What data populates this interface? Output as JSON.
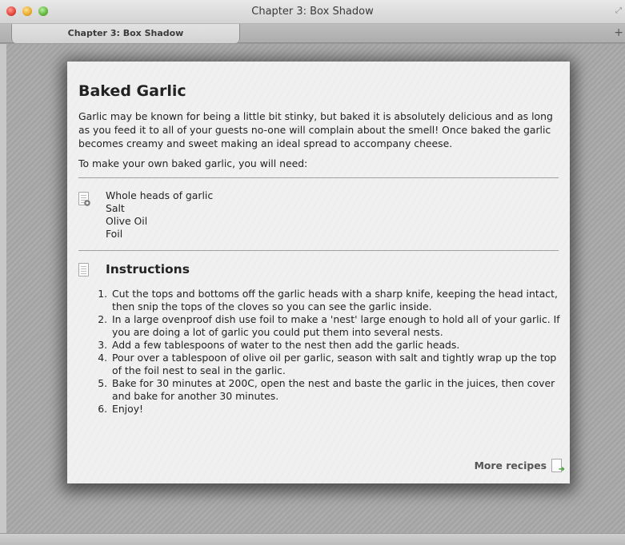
{
  "window": {
    "title": "Chapter 3: Box Shadow"
  },
  "tabs": [
    {
      "label": "Chapter 3: Box Shadow",
      "active": true
    }
  ],
  "icons": {
    "new_tab": "plus-icon",
    "resize": "resize-icon",
    "ingredients": "document-gear-icon",
    "instructions": "document-icon",
    "more": "document-arrow-icon"
  },
  "article": {
    "title": "Baked Garlic",
    "intro": "Garlic may be known for being a little bit stinky, but baked it is absolutely delicious and as long as you feed it to all of your guests no-one will complain about the smell! Once baked the garlic becomes creamy and sweet making an ideal spread to accompany cheese.",
    "need": "To make your own baked garlic, you will need:",
    "ingredients": [
      "Whole heads of garlic",
      "Salt",
      "Olive Oil",
      "Foil"
    ],
    "instructions_title": "Instructions",
    "steps": [
      "Cut the tops and bottoms off the garlic heads with a sharp knife, keeping the head intact, then snip the tops of the cloves so you can see the garlic inside.",
      "In a large ovenproof dish use foil to make a 'nest' large enough to hold all of your garlic. If you are doing a lot of garlic you could put them into several nests.",
      "Add a few tablespoons of water to the nest then add the garlic heads.",
      "Pour over a tablespoon of olive oil per garlic, season with salt and tightly wrap up the top of the foil nest to seal in the garlic.",
      "Bake for 30 minutes at 200C, open the nest and baste the garlic in the juices, then cover and bake for another 30 minutes.",
      "Enjoy!"
    ],
    "more_label": "More recipes"
  }
}
